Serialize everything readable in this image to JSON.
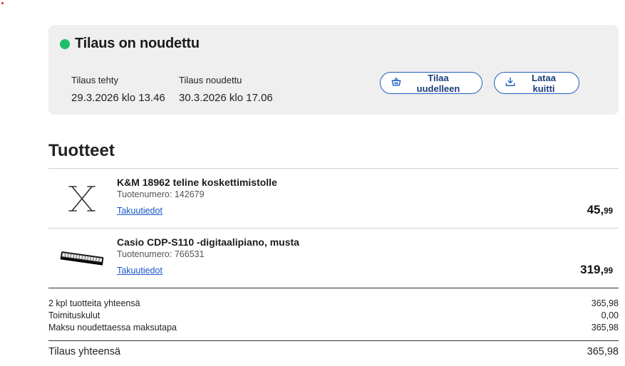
{
  "status": {
    "title": "Tilaus on noudettu",
    "dot_color": "#1fbf6a",
    "ordered_label": "Tilaus tehty",
    "ordered_value": "29.3.2026 klo 13.46",
    "picked_label": "Tilaus noudettu",
    "picked_value": "30.3.2026 klo 17.06",
    "reorder_label": "Tilaa uudelleen",
    "reorder_icon": "basket-icon",
    "receipt_label": "Lataa kuitti",
    "receipt_icon": "download-icon"
  },
  "products_title": "Tuotteet",
  "products": [
    {
      "name": "K&M 18962 teline koskettimistolle",
      "sku_label": "Tuotenumero:",
      "sku": "142679",
      "warranty_label": "Takuutiedot",
      "price_int": "45,",
      "price_dec": "99",
      "image_icon": "keyboard-stand-icon"
    },
    {
      "name": "Casio CDP-S110 -digitaalipiano, musta",
      "sku_label": "Tuotenumero:",
      "sku": "766531",
      "warranty_label": "Takuutiedot",
      "price_int": "319,",
      "price_dec": "99",
      "image_icon": "digital-piano-icon"
    }
  ],
  "summary": {
    "items_label": "2 kpl tuotteita yhteensä",
    "items_value": "365,98",
    "shipping_label": "Toimituskulut",
    "shipping_value": "0,00",
    "payment_label": "Maksu noudettaessa maksutapa",
    "payment_value": "365,98",
    "total_label": "Tilaus yhteensä",
    "total_value": "365,98"
  },
  "colors": {
    "accent": "#1f5fbf",
    "link": "#1a56c4",
    "card_bg": "#efefef"
  }
}
